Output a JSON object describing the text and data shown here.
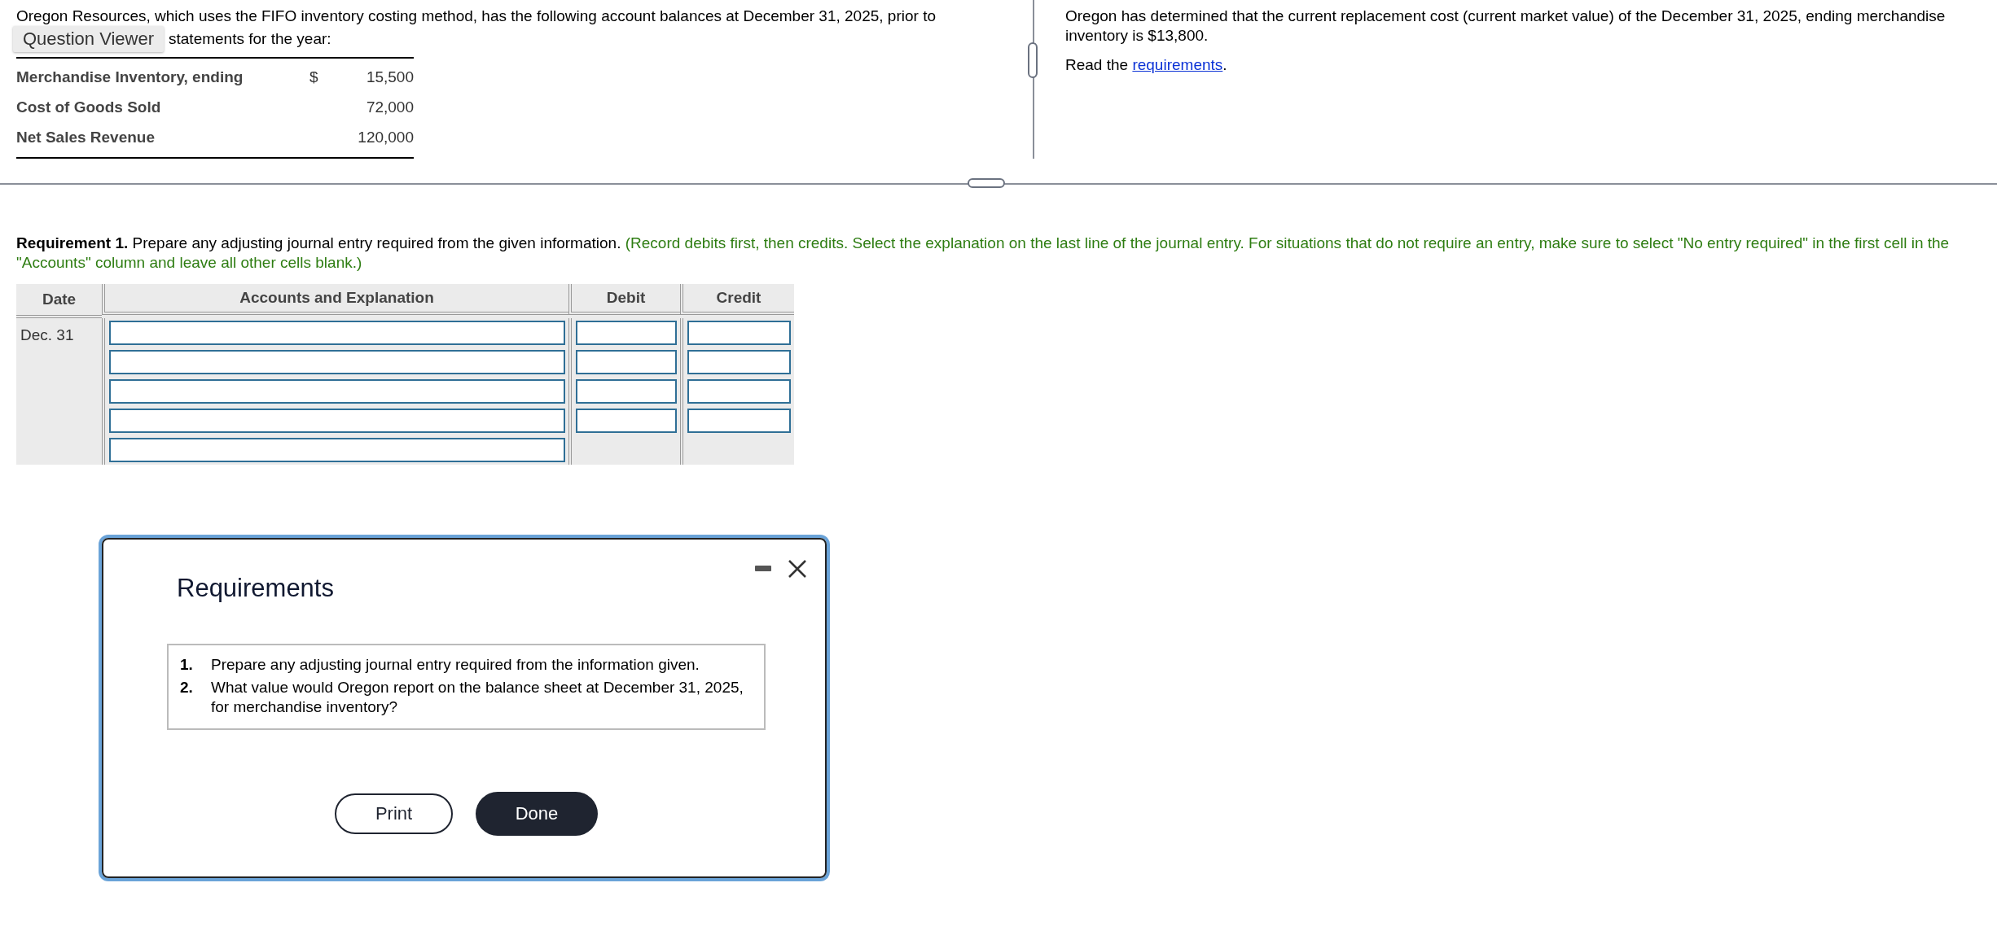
{
  "question_viewer": {
    "label": "Question Viewer"
  },
  "intro": {
    "line_1": "Oregon Resources, which uses the FIFO inventory costing method, has the following account balances at December 31, 2025, prior to",
    "line_2": "statements for the year:"
  },
  "balances": [
    {
      "account": "Merchandise Inventory, ending",
      "currency": "$",
      "amount": "15,500"
    },
    {
      "account": "Cost of Goods Sold",
      "amount": "72,000"
    },
    {
      "account": "Net Sales Revenue",
      "amount": "120,000"
    }
  ],
  "info": {
    "text": "Oregon has determined that the current replacement cost (current market value) of the December 31, 2025, ending merchandise inventory is $13,800.",
    "read_prefix": "Read the",
    "link": "requirements",
    "read_suffix": "."
  },
  "requirement": {
    "text": "**Requirement 1.** Prepare any adjusting journal entry required from the given information.",
    "instructions": "(Record debits first, then credits. Select the explanation on the last line of the journal entry. For situations that do not require an entry, make sure to select \"No entry required\" in the first cell in the \"Accounts\" column and leave all other cells blank.)"
  },
  "journal": {
    "columns": [
      "Date",
      "Accounts and Explanation",
      "Debit",
      "Credit"
    ],
    "date": "Dec. 31",
    "rows": [
      {
        "kind": "entry"
      },
      {
        "kind": "entry"
      },
      {
        "kind": "entry"
      },
      {
        "kind": "entry"
      },
      {
        "kind": "explanation"
      }
    ]
  },
  "modal": {
    "title": "Requirements",
    "items": [
      {
        "number": "1.",
        "text": "Prepare any adjusting journal entry required from the information given."
      },
      {
        "number": "2.",
        "text": "What value would Oregon report on the balance sheet at December 31, 2025, for merchandise inventory?"
      }
    ],
    "buttons": [
      {
        "label": "Print",
        "kind": "secondary"
      },
      {
        "label": "Done",
        "kind": "primary"
      }
    ]
  }
}
